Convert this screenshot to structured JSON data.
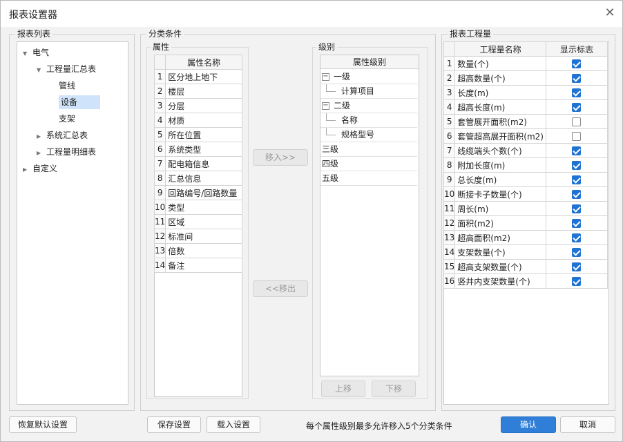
{
  "window": {
    "title": "报表设置器"
  },
  "report_list": {
    "legend": "报表列表",
    "tree": [
      {
        "label": "电气",
        "expanded": true
      },
      {
        "label": "工程量汇总表",
        "expanded": true
      },
      {
        "label": "管线"
      },
      {
        "label": "设备",
        "selected": true
      },
      {
        "label": "支架"
      },
      {
        "label": "系统汇总表",
        "expanded": false
      },
      {
        "label": "工程量明细表",
        "expanded": false
      },
      {
        "label": "自定义",
        "expanded": false
      }
    ]
  },
  "category": {
    "legend": "分类条件",
    "attributes": {
      "legend": "属性",
      "header": "属性名称",
      "rows": [
        "区分地上地下",
        "楼层",
        "分层",
        "材质",
        "所在位置",
        "系统类型",
        "配电箱信息",
        "汇总信息",
        "回路编号/回路数量",
        "类型",
        "区域",
        "标准间",
        "倍数",
        "备注"
      ]
    },
    "levels": {
      "legend": "级别",
      "header": "属性级别",
      "rows": [
        {
          "label": "一级",
          "group": true
        },
        {
          "label": "计算项目",
          "child": true
        },
        {
          "label": "二级",
          "group": true
        },
        {
          "label": "名称",
          "child": true
        },
        {
          "label": "规格型号",
          "child": true
        },
        {
          "label": "三级"
        },
        {
          "label": "四级"
        },
        {
          "label": "五级"
        }
      ]
    },
    "move_in_label": "移入>>",
    "move_out_label": "<<移出",
    "up_label": "上移",
    "down_label": "下移"
  },
  "quantities": {
    "legend": "报表工程量",
    "col_name": "工程量名称",
    "col_show": "显示标志",
    "rows": [
      {
        "name": "数量(个)",
        "checked": true
      },
      {
        "name": "超高数量(个)",
        "checked": true
      },
      {
        "name": "长度(m)",
        "checked": true
      },
      {
        "name": "超高长度(m)",
        "checked": true
      },
      {
        "name": "套管展开面积(m2)",
        "checked": false
      },
      {
        "name": "套管超高展开面积(m2)",
        "checked": false
      },
      {
        "name": "线缆端头个数(个)",
        "checked": true
      },
      {
        "name": "附加长度(m)",
        "checked": true
      },
      {
        "name": "总长度(m)",
        "checked": true
      },
      {
        "name": "断接卡子数量(个)",
        "checked": true
      },
      {
        "name": "周长(m)",
        "checked": true
      },
      {
        "name": "面积(m2)",
        "checked": true
      },
      {
        "name": "超高面积(m2)",
        "checked": true
      },
      {
        "name": "支架数量(个)",
        "checked": true
      },
      {
        "name": "超高支架数量(个)",
        "checked": true
      },
      {
        "name": "竖井内支架数量(个)",
        "checked": true
      }
    ]
  },
  "footer": {
    "restore_label": "恢复默认设置",
    "save_label": "保存设置",
    "load_label": "载入设置",
    "hint": "每个属性级别最多允许移入5个分类条件",
    "ok_label": "确认",
    "cancel_label": "取消"
  },
  "colors": {
    "accent": "#2f7ed8",
    "selection": "#cfe4fa"
  }
}
